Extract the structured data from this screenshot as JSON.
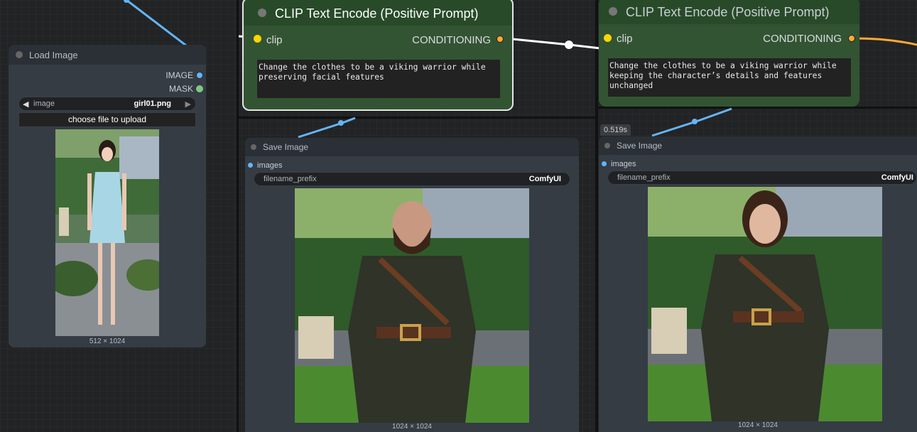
{
  "load_image": {
    "title": "Load Image",
    "outputs": [
      "IMAGE",
      "MASK"
    ],
    "image_label": "image",
    "image_value": "girl01.png",
    "upload_label": "choose file to upload",
    "dims": "512 × 1024"
  },
  "clip_nodes": [
    {
      "title": "CLIP Text Encode (Positive Prompt)",
      "input": "clip",
      "output": "CONDITIONING",
      "text": "Change the clothes to be a viking warrior while\npreserving facial features"
    },
    {
      "title": "CLIP Text Encode (Positive Prompt)",
      "input": "clip",
      "output": "CONDITIONING",
      "text": "Change the clothes to be a viking warrior while\nkeeping the character’s details and features\nunchanged"
    }
  ],
  "save_nodes": [
    {
      "title": "Save Image",
      "input": "images",
      "prefix_label": "filename_prefix",
      "prefix_value": "ComfyUI",
      "dims": "1024 × 1024"
    },
    {
      "title": "Save Image",
      "input": "images",
      "prefix_label": "filename_prefix",
      "prefix_value": "ComfyUI",
      "dims": "1024 × 1024",
      "timing": "0.519s"
    }
  ],
  "colors": {
    "image_link": "#64b5f6",
    "conditioning_link": "#ffa931",
    "clip_slot": "#ffd500",
    "mask_slot": "#81c784"
  }
}
